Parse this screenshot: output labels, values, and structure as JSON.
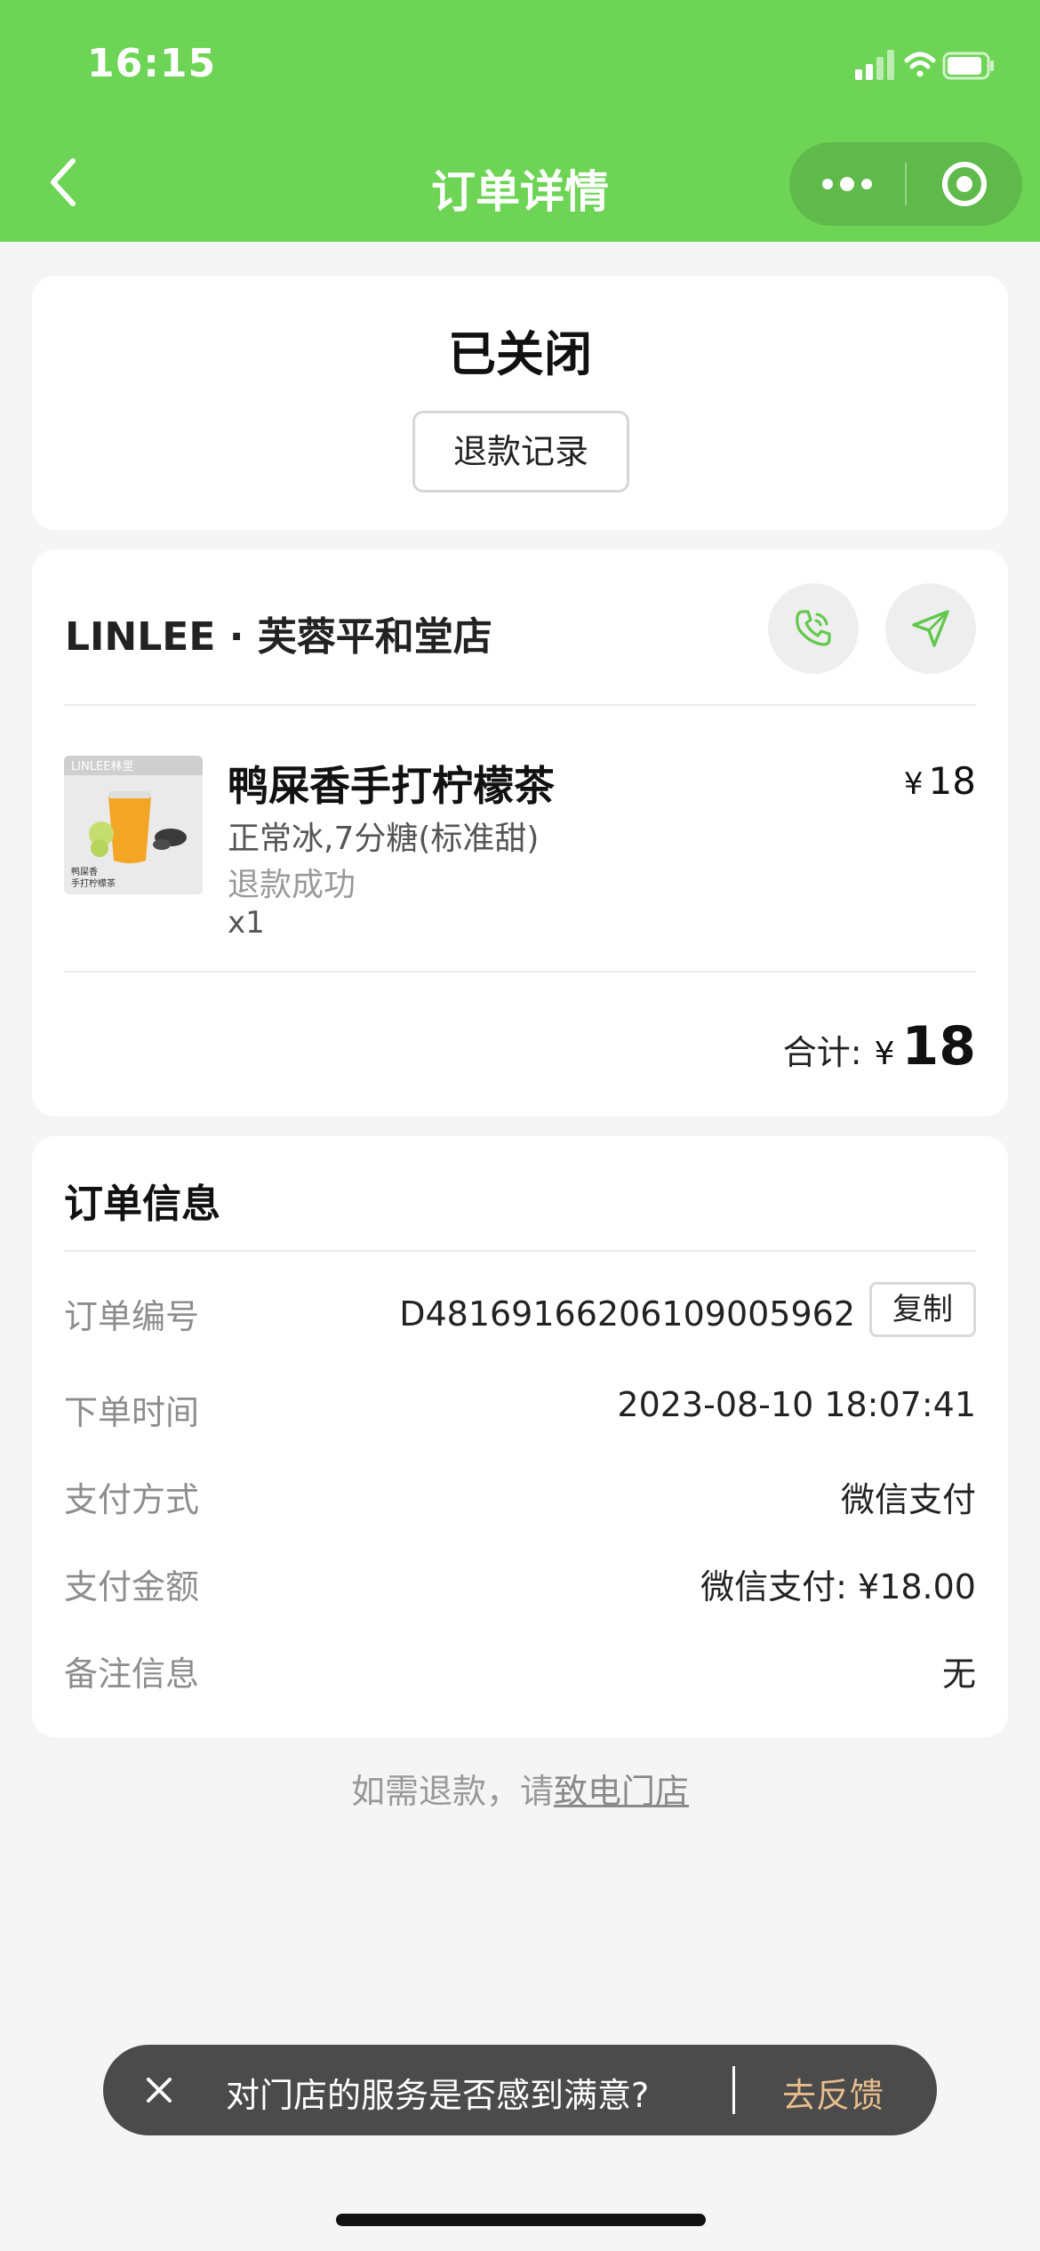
{
  "status_bar": {
    "time": "16:15"
  },
  "nav": {
    "title": "订单详情",
    "back_icon": "back-chevron-icon",
    "more_icon": "more-dots-icon",
    "close_icon": "target-circle-icon"
  },
  "order_status": {
    "title": "已关闭",
    "refund_record_label": "退款记录"
  },
  "store": {
    "name": "LINLEE · 芙蓉平和堂店",
    "phone_icon": "phone-icon",
    "navigate_icon": "navigate-icon"
  },
  "product": {
    "name": "鸭屎香手打柠檬茶",
    "spec": "正常冰,7分糖(标准甜)",
    "refund_status": "退款成功",
    "qty": "x1",
    "price_symbol": "¥",
    "price": "18",
    "image_text_brand": "LINLEE林里",
    "image_caption_1": "鸭屎香",
    "image_caption_2": "手打柠檬茶"
  },
  "total": {
    "label": "合计:",
    "symbol": "¥",
    "value": "18"
  },
  "order_info": {
    "title": "订单信息",
    "rows": [
      {
        "key": "订单编号",
        "value": "D4816916620610900596​2"
      },
      {
        "key": "下单时间",
        "value": "2023-08-10 18:07:41"
      },
      {
        "key": "支付方式",
        "value": "微信支付"
      },
      {
        "key": "支付金额",
        "value": "微信支付: ¥18.00"
      },
      {
        "key": "备注信息",
        "value": "无"
      }
    ],
    "copy_label": "复制"
  },
  "refund_tip": {
    "prefix": "如需退款，请",
    "link": "致电门店"
  },
  "feedback": {
    "text": "对门店的服务是否感到满意?",
    "link": "去反馈"
  },
  "colors": {
    "header_green": "#6dd456",
    "accent_green": "#62c84c",
    "feedback_link": "#e8bd8d"
  }
}
